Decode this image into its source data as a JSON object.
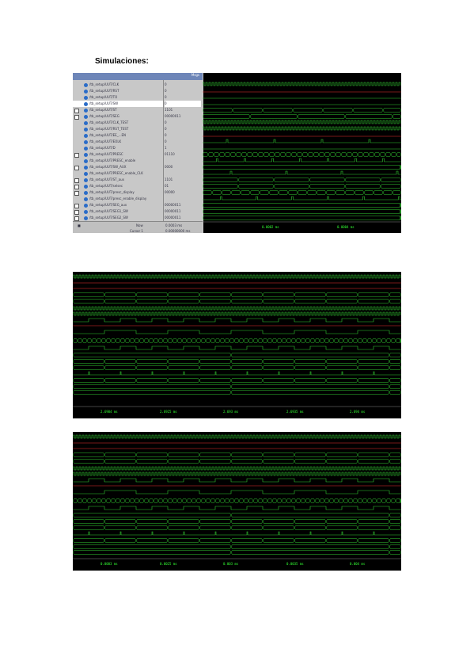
{
  "title": "Simulaciones:",
  "panel1": {
    "header_label": "Msgs",
    "signals": [
      {
        "name": "/tb_setup/UUT/CLK",
        "value": "0"
      },
      {
        "name": "/tb_setup/UUT/RST",
        "value": "0"
      },
      {
        "name": "/tb_setup/UUT/TO",
        "value": "0"
      },
      {
        "name": "/tb_setup/UUT/SW",
        "value": "0"
      },
      {
        "name": "/tb_setup/UUT/ST",
        "value": "1101"
      },
      {
        "name": "/tb_setup/UUT/SEG",
        "value": "00000011"
      },
      {
        "name": "/tb_setup/UUT/CLK_TEST",
        "value": "0"
      },
      {
        "name": "/tb_setup/UUT/RST_TEST",
        "value": "0"
      },
      {
        "name": "/tb_setup/UUT/EE_...EN",
        "value": "0"
      },
      {
        "name": "/tb_setup/UUT/EOLK",
        "value": "0"
      },
      {
        "name": "/tb_setup/UUT/D",
        "value": "1"
      },
      {
        "name": "/tb_setup/UUT/PRESC",
        "value": "01110"
      },
      {
        "name": "/tb_setup/UUT/PRESC_enable",
        "value": ""
      },
      {
        "name": "/tb_setup/UUT/SW_AUX",
        "value": "0000"
      },
      {
        "name": "/tb_setup/UUT/PRESC_enable_CLK",
        "value": ""
      },
      {
        "name": "/tb_setup/UUT/ST_aux",
        "value": "1101"
      },
      {
        "name": "/tb_setup/UUT/selsec",
        "value": "01"
      },
      {
        "name": "/tb_setup/UUT/presc_display",
        "value": "00000"
      },
      {
        "name": "/tb_setup/UUT/presc_enable_display",
        "value": ""
      },
      {
        "name": "/tb_setup/UUT/SEG_aux",
        "value": "00000011"
      },
      {
        "name": "/tb_setup/UUT/SEG1_SW",
        "value": "00000011"
      },
      {
        "name": "/tb_setup/UUT/SEG2_SW",
        "value": "00000011"
      }
    ],
    "footer": {
      "now_label": "Now",
      "now_value": "0.0003 ms",
      "cursor_label": "Cursor 1",
      "cursor_value": "0.00000000 ms"
    },
    "time_ticks": [
      "0.0002 ms",
      "0.0004 ms"
    ]
  },
  "panel2": {
    "time_ticks": [
      "2.6904 ms",
      "2.6925 ms",
      "2.693 ms",
      "2.6935 ms",
      "2.694 ms"
    ]
  },
  "panel3": {
    "time_ticks": [
      "0.0003 ms",
      "0.0025 ms",
      "0.003 ms",
      "0.0035 ms",
      "0.004 ms"
    ]
  }
}
